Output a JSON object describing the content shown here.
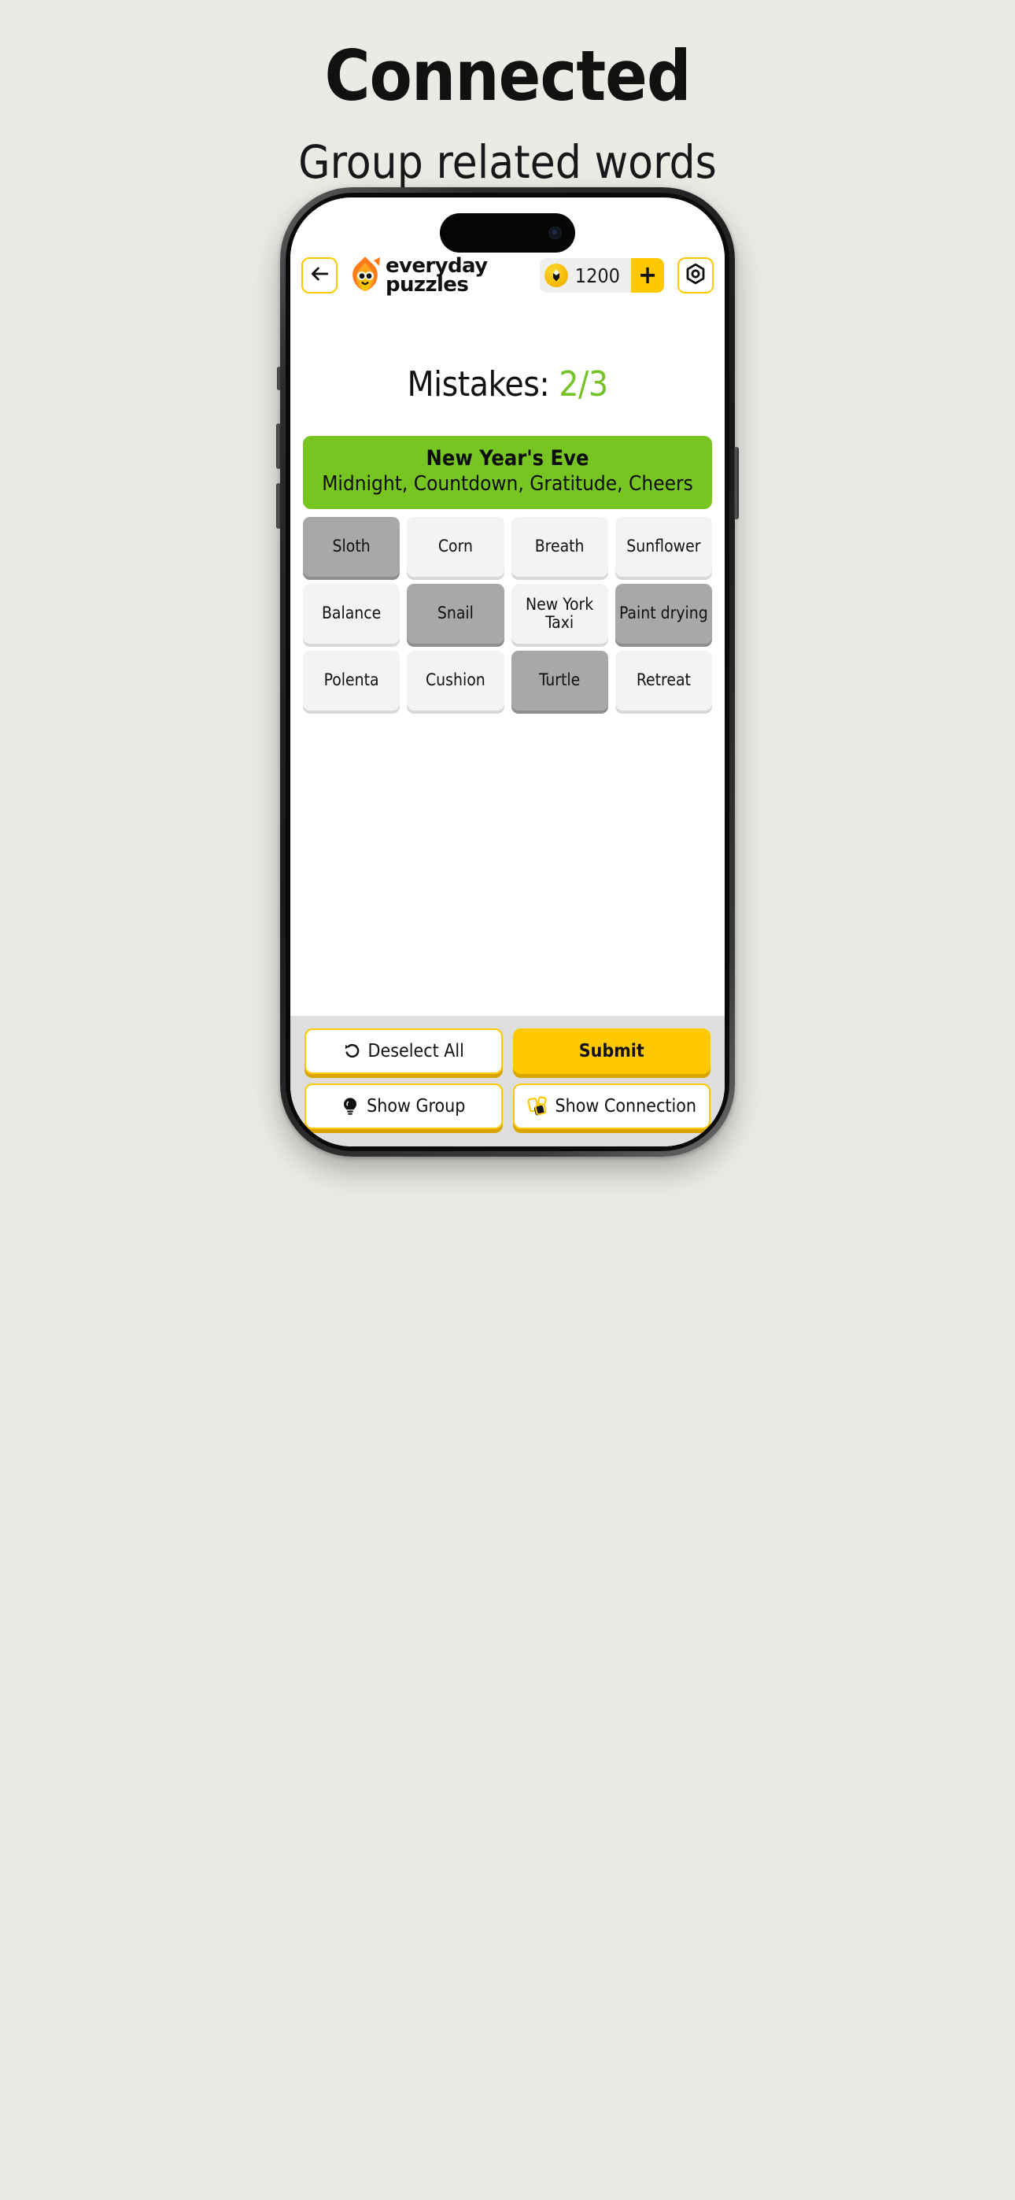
{
  "promo": {
    "title": "Connected",
    "subtitle": "Group related words"
  },
  "app": {
    "header": {
      "back_icon": "arrow-left-icon",
      "logo_line1": "everyday",
      "logo_line2": "puzzles",
      "logo_icon": "flame-mascot-icon",
      "coin_icon": "coin-icon",
      "coin_amount": "1200",
      "coin_add_label": "+",
      "settings_icon": "gear-nut-icon"
    },
    "status": {
      "mistakes_label": "Mistakes:",
      "mistakes_value": "2/3",
      "mistakes_value_color": "#74C327"
    },
    "solved_groups": [
      {
        "title": "New Year's Eve",
        "words": "Midnight, Countdown, Gratitude, Cheers",
        "color": "#76C521"
      }
    ],
    "grid": {
      "tiles": [
        {
          "label": "Sloth",
          "selected": true
        },
        {
          "label": "Corn",
          "selected": false
        },
        {
          "label": "Breath",
          "selected": false
        },
        {
          "label": "Sunflower",
          "selected": false
        },
        {
          "label": "Balance",
          "selected": false
        },
        {
          "label": "Snail",
          "selected": true
        },
        {
          "label": "New York Taxi",
          "selected": false
        },
        {
          "label": "Paint drying",
          "selected": true
        },
        {
          "label": "Polenta",
          "selected": false
        },
        {
          "label": "Cushion",
          "selected": false
        },
        {
          "label": "Turtle",
          "selected": true
        },
        {
          "label": "Retreat",
          "selected": false
        }
      ]
    },
    "actions": {
      "deselect_all": "Deselect All",
      "deselect_icon": "undo-arrow-icon",
      "submit": "Submit",
      "show_group": "Show Group",
      "show_group_icon": "lightbulb-icon",
      "show_connection": "Show Connection",
      "show_connection_icon": "cards-icon"
    }
  },
  "colors": {
    "page_background": "#ECEAE5",
    "accent_yellow": "#FFC800",
    "solved_green": "#76C521",
    "tile_default": "#F3F3F3",
    "tile_selected": "#A8A8A8",
    "action_bar": "#DEDEDE"
  }
}
